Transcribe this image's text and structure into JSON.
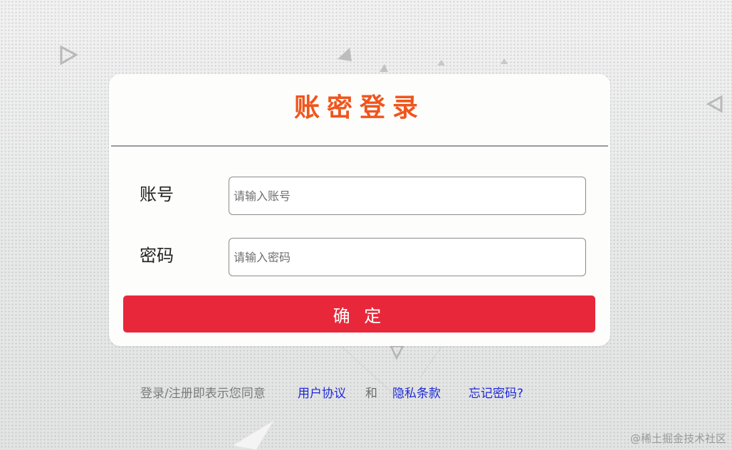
{
  "login": {
    "title": "账密登录",
    "account_label": "账号",
    "account_placeholder": "请输入账号",
    "account_value": "",
    "password_label": "密码",
    "password_placeholder": "请输入密码",
    "password_value": "",
    "confirm_label": "确 定"
  },
  "footer": {
    "agree_prefix": "登录/注册即表示您同意",
    "terms_link": "用户协议",
    "and_text": "和",
    "privacy_link": "隐私条款",
    "forgot_link": "忘记密码?"
  },
  "watermark": "@稀土掘金技术社区",
  "colors": {
    "title": "#f0551c",
    "button": "#e8283a",
    "link": "#1f2bd6",
    "background": "#eceded"
  }
}
